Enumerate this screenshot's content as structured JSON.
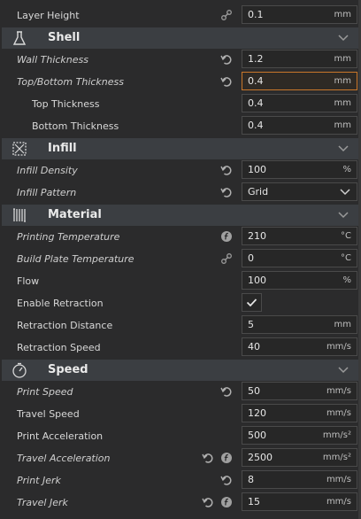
{
  "settings": {
    "layer_height": {
      "label": "Layer Height",
      "value": "0.1",
      "unit": "mm"
    },
    "shell": {
      "title": "Shell",
      "wall_thickness": {
        "label": "Wall Thickness",
        "value": "1.2",
        "unit": "mm"
      },
      "top_bottom_thickness": {
        "label": "Top/Bottom Thickness",
        "value": "0.4",
        "unit": "mm"
      },
      "top_thickness": {
        "label": "Top Thickness",
        "value": "0.4",
        "unit": "mm"
      },
      "bottom_thickness": {
        "label": "Bottom Thickness",
        "value": "0.4",
        "unit": "mm"
      }
    },
    "infill": {
      "title": "Infill",
      "density": {
        "label": "Infill Density",
        "value": "100",
        "unit": "%"
      },
      "pattern": {
        "label": "Infill Pattern",
        "value": "Grid"
      }
    },
    "material": {
      "title": "Material",
      "print_temp": {
        "label": "Printing Temperature",
        "value": "210",
        "unit": "°C"
      },
      "plate_temp": {
        "label": "Build Plate Temperature",
        "value": "0",
        "unit": "°C"
      },
      "flow": {
        "label": "Flow",
        "value": "100",
        "unit": "%"
      },
      "retraction": {
        "label": "Enable Retraction",
        "checked": true
      },
      "retract_distance": {
        "label": "Retraction Distance",
        "value": "5",
        "unit": "mm"
      },
      "retract_speed": {
        "label": "Retraction Speed",
        "value": "40",
        "unit": "mm/s"
      }
    },
    "speed": {
      "title": "Speed",
      "print_speed": {
        "label": "Print Speed",
        "value": "50",
        "unit": "mm/s"
      },
      "travel_speed": {
        "label": "Travel Speed",
        "value": "120",
        "unit": "mm/s"
      },
      "print_accel": {
        "label": "Print Acceleration",
        "value": "500",
        "unit": "mm/s²"
      },
      "travel_accel": {
        "label": "Travel Acceleration",
        "value": "2500",
        "unit": "mm/s²"
      },
      "print_jerk": {
        "label": "Print Jerk",
        "value": "8",
        "unit": "mm/s"
      },
      "travel_jerk": {
        "label": "Travel Jerk",
        "value": "15",
        "unit": "mm/s"
      }
    }
  },
  "colors": {
    "background": "#2b2b2c",
    "section": "#3b3e42",
    "focus_border": "#c9772a"
  }
}
